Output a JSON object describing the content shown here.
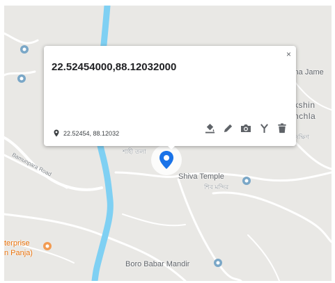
{
  "popup": {
    "title": "22.52454000,88.12032000",
    "coords": "22.52454, 88.12032",
    "close_glyph": "×",
    "tools": [
      "paint-bucket-icon",
      "pencil-icon",
      "camera-icon",
      "fork-icon",
      "trash-icon"
    ]
  },
  "map": {
    "labels": {
      "dina_jame": "dina Jame",
      "kshin": "kshin",
      "nchla": "nchla",
      "bengali_right": "দক্ষিণ",
      "bengali_left": "শাহী তলা",
      "shiva_temple": "Shiva Temple",
      "shiva_temple_bn": "শিব মন্দির",
      "enterprise_1": "terprise",
      "enterprise_2": "n Panja)",
      "boro_babar_mandir": "Boro Babar Mandir",
      "road": "Bamunpara Road"
    },
    "colors": {
      "background": "#e9e8e5",
      "road": "#ffffff",
      "river": "#7fd0f3",
      "pin": "#1a73e8",
      "poi": "#7aa7c7",
      "poi_orange": "#f29b52"
    }
  }
}
